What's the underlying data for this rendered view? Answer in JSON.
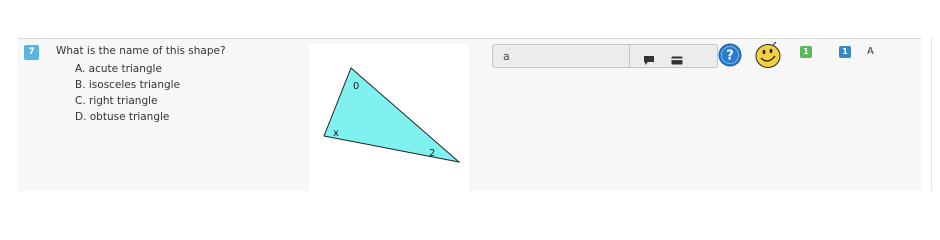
{
  "question": {
    "number": "7",
    "prompt": "What is the name of this shape?",
    "choices": [
      "A. acute triangle",
      "B. isosceles triangle",
      "C. right triangle",
      "D. obtuse triangle"
    ],
    "figure": {
      "fill_color": "#7ff2f0",
      "vertex_labels": [
        "0",
        "x",
        "2"
      ]
    }
  },
  "response": {
    "value": "a",
    "comment_icon": "comment-icon",
    "card_icon": "card-icon"
  },
  "status": {
    "help_icon": "help-icon",
    "smiley_icon": "smiley-icon",
    "score": "1",
    "attempts": "1",
    "correct_answer": "A"
  },
  "colors": {
    "question_badge": "#5bb3e0",
    "score_badge": "#5cb85c",
    "attempt_badge": "#3a87c8",
    "help_blue": "#2a7ad0",
    "smiley_yellow": "#f4d03f",
    "row_background": "#f7f7f7"
  }
}
